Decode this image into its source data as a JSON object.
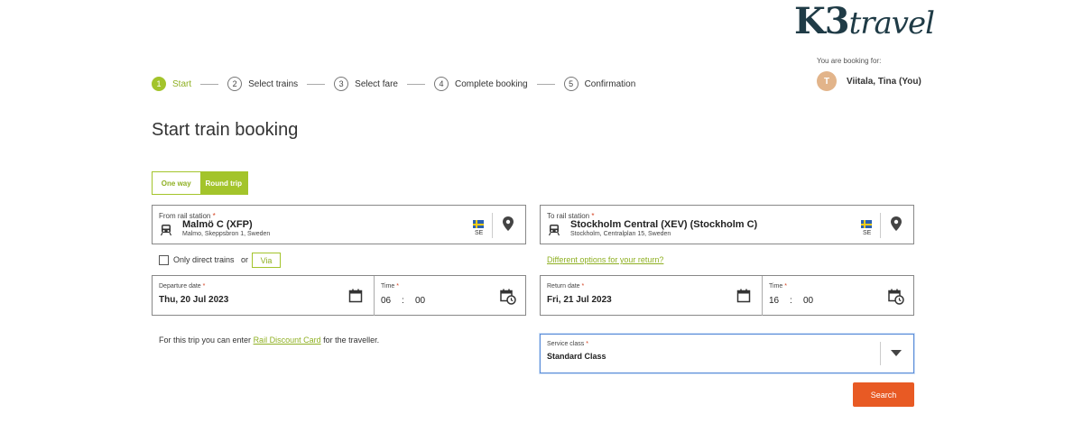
{
  "brand": {
    "logo_text_main": "K3",
    "logo_text_sub": "travel"
  },
  "booking_for": {
    "label": "You are booking for:",
    "avatar_initial": "T",
    "user": "Viitala, Tina (You)"
  },
  "steps": [
    {
      "num": "1",
      "label": "Start",
      "active": true
    },
    {
      "num": "2",
      "label": "Select trains"
    },
    {
      "num": "3",
      "label": "Select fare"
    },
    {
      "num": "4",
      "label": "Complete booking"
    },
    {
      "num": "5",
      "label": "Confirmation"
    }
  ],
  "page_title": "Start train booking",
  "trip_type": {
    "one_way": "One way",
    "round_trip": "Round trip",
    "selected": "Round trip"
  },
  "from": {
    "label": "From rail station",
    "required": "*",
    "name": "Malmö C (XFP)",
    "address": "Malmo, Skeppsbron 1, Sweden",
    "country": "SE"
  },
  "to": {
    "label": "To rail station",
    "required": "*",
    "name": "Stockholm Central (XEV) (Stockholm C)",
    "address": "Stockholm, Centralplan 15, Sweden",
    "country": "SE"
  },
  "options": {
    "direct_label": "Only direct trains",
    "or": "or",
    "via": "Via",
    "different_return": "Different options for your return?"
  },
  "departure": {
    "date_label": "Departure date",
    "date": "Thu, 20 Jul 2023",
    "time_label": "Time",
    "hour": "06",
    "colon": ":",
    "minute": "00",
    "required": "*"
  },
  "return": {
    "date_label": "Return date",
    "date": "Fri, 21 Jul 2023",
    "time_label": "Time",
    "hour": "16",
    "colon": ":",
    "minute": "00",
    "required": "*"
  },
  "discount": {
    "prefix": "For this trip you can enter",
    "link": "Rail Discount Card",
    "suffix": "for the traveller."
  },
  "service_class": {
    "label": "Service class",
    "required": "*",
    "value": "Standard Class"
  },
  "search_label": "Search",
  "colors": {
    "accent": "#a3c42b",
    "cta": "#e85a24",
    "focus": "#5a8cd8"
  }
}
